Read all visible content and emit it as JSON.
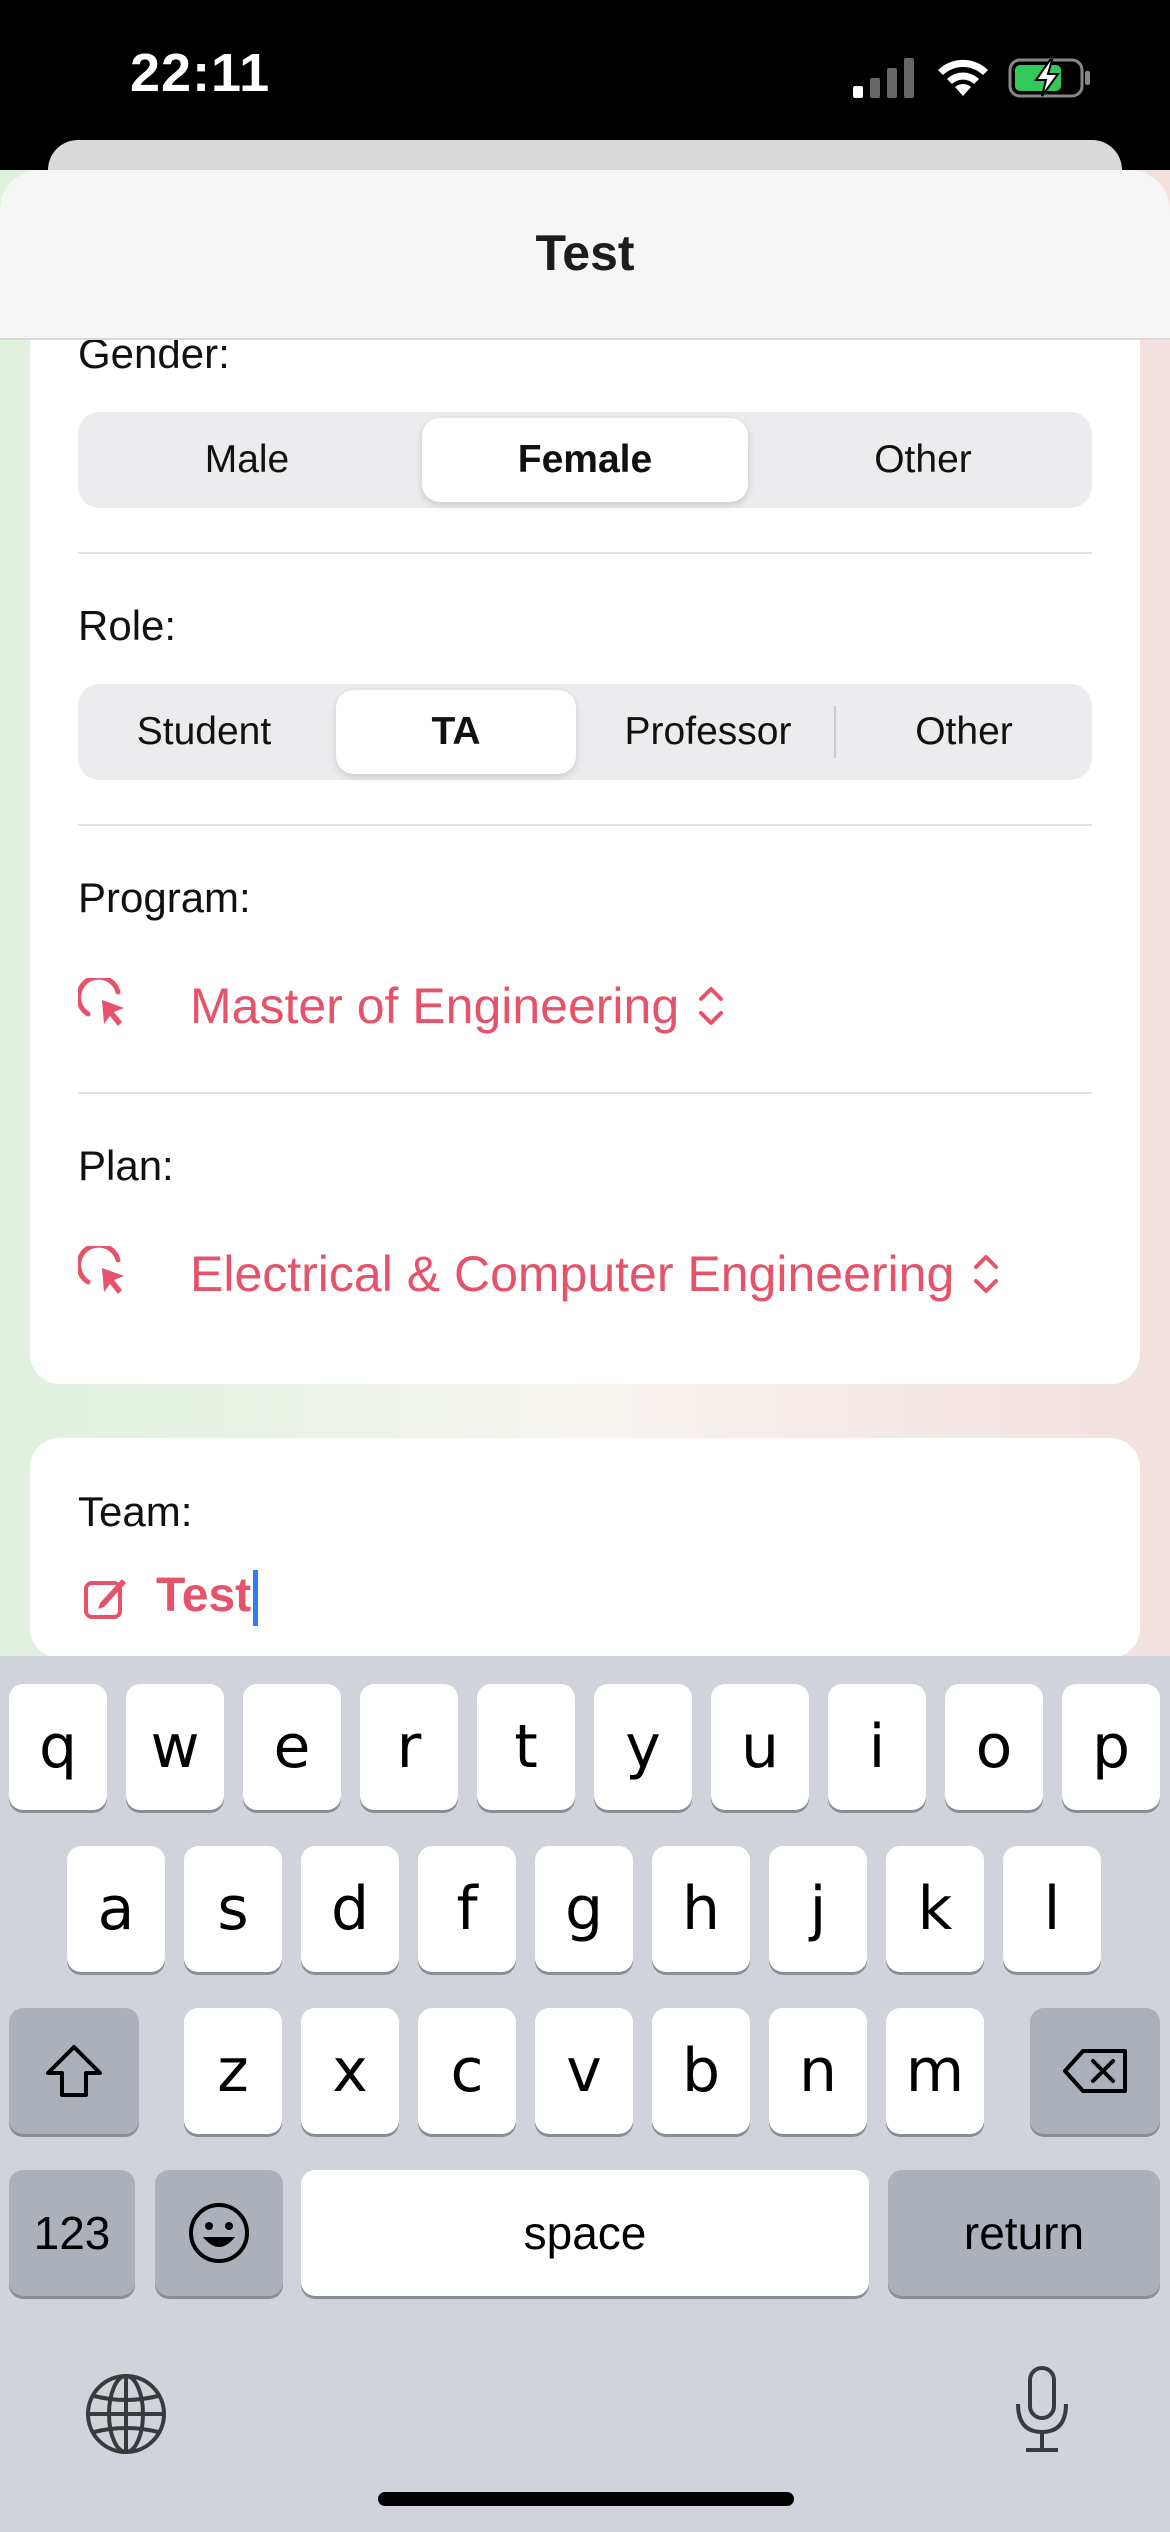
{
  "status_bar": {
    "time": "22:11",
    "icons": [
      "cellular-signal-icon",
      "wifi-icon",
      "battery-charging-icon"
    ]
  },
  "sheet": {
    "title": "Test"
  },
  "form": {
    "gender": {
      "label": "Gender:",
      "options": [
        "Male",
        "Female",
        "Other"
      ],
      "selected": "Female"
    },
    "role": {
      "label": "Role:",
      "options": [
        "Student",
        "TA",
        "Professor",
        "Other"
      ],
      "selected": "TA"
    },
    "program": {
      "label": "Program:",
      "value": "Master of Engineering",
      "icon": "pointer-icon"
    },
    "plan": {
      "label": "Plan:",
      "value": "Electrical & Computer Engineering",
      "icon": "pointer-icon"
    },
    "team": {
      "label": "Team:",
      "value": "Test",
      "icon": "edit-icon"
    }
  },
  "keyboard": {
    "row1": [
      "q",
      "w",
      "e",
      "r",
      "t",
      "y",
      "u",
      "i",
      "o",
      "p"
    ],
    "row2": [
      "a",
      "s",
      "d",
      "f",
      "g",
      "h",
      "j",
      "k",
      "l"
    ],
    "row3": [
      "z",
      "x",
      "c",
      "v",
      "b",
      "n",
      "m"
    ],
    "numbers_label": "123",
    "space_label": "space",
    "return_label": "return"
  },
  "colors": {
    "accent": "#e5536a",
    "caret": "#2f7cf6",
    "keyboard_bg": "#d1d3da"
  }
}
